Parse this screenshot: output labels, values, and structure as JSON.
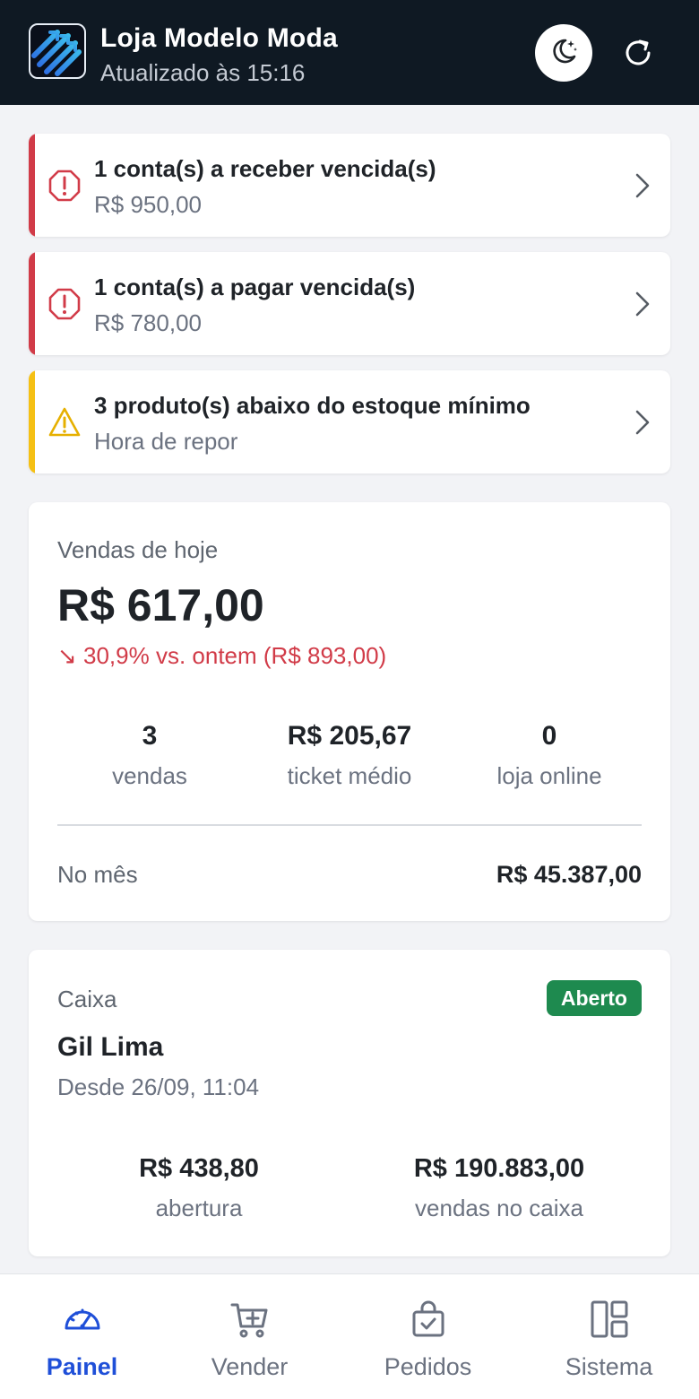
{
  "header": {
    "title": "Loja Modelo Moda",
    "subtitle": "Atualizado às 15:16"
  },
  "alerts": [
    {
      "title": "1 conta(s) a receber vencida(s)",
      "subtitle": "R$ 950,00",
      "level": "danger",
      "color": "#d13b48"
    },
    {
      "title": "1 conta(s) a pagar vencida(s)",
      "subtitle": "R$ 780,00",
      "level": "danger",
      "color": "#d13b48"
    },
    {
      "title": "3 produto(s) abaixo do estoque mínimo",
      "subtitle": "Hora de repor",
      "level": "warning",
      "color": "#f5c014"
    }
  ],
  "sales": {
    "label": "Vendas de hoje",
    "total": "R$ 617,00",
    "comparison": "↘ 30,9% vs. ontem (R$ 893,00)",
    "stats": [
      {
        "value": "3",
        "label": "vendas"
      },
      {
        "value": "R$ 205,67",
        "label": "ticket médio"
      },
      {
        "value": "0",
        "label": "loja online"
      }
    ],
    "month_label": "No mês",
    "month_value": "R$ 45.387,00"
  },
  "cash": {
    "label": "Caixa",
    "status": "Aberto",
    "status_color": "#1e8a4f",
    "operator": "Gil Lima",
    "since": "Desde 26/09, 11:04",
    "stats": [
      {
        "value": "R$ 438,80",
        "label": "abertura"
      },
      {
        "value": "R$ 190.883,00",
        "label": "vendas no caixa"
      }
    ]
  },
  "nav": {
    "items": [
      {
        "label": "Painel",
        "icon": "dashboard-gauge-icon",
        "active": true
      },
      {
        "label": "Vender",
        "icon": "cart-plus-icon",
        "active": false
      },
      {
        "label": "Pedidos",
        "icon": "shopping-bag-check-icon",
        "active": false
      },
      {
        "label": "Sistema",
        "icon": "layout-grid-icon",
        "active": false
      }
    ],
    "active_color": "#1f4fd8"
  }
}
